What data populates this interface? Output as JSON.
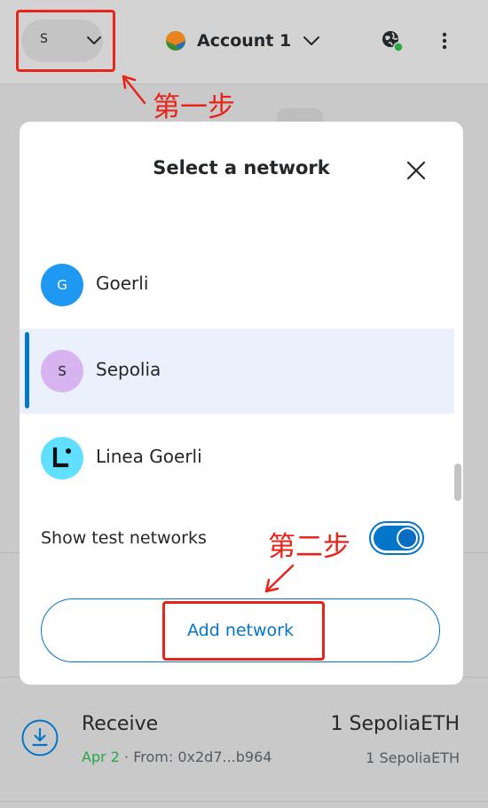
{
  "header": {
    "network_letter": "S",
    "account_name": "Account 1"
  },
  "modal": {
    "title": "Select a network",
    "networks": [
      {
        "label": "Goerli",
        "avatar_letter": "G",
        "avatar_bg": "#1e98f0",
        "avatar_fg": "#ffffff",
        "selected": false
      },
      {
        "label": "Sepolia",
        "avatar_letter": "S",
        "avatar_bg": "#d7b4f0",
        "avatar_fg": "#24272a",
        "selected": true
      },
      {
        "label": "Linea Goerli",
        "avatar_letter": "",
        "avatar_bg": "#61dfff",
        "avatar_fg": "#121212",
        "selected": false
      }
    ],
    "toggle_label": "Show test networks",
    "toggle_on": true,
    "add_network_label": "Add network"
  },
  "activity": {
    "title": "Receive",
    "amount": "1 SepoliaETH",
    "date": "Apr 2",
    "from": " · From: 0x2d7...b964",
    "sub_amount": "1 SepoliaETH"
  },
  "annotations": {
    "step1": "第一步",
    "step2": "第二步"
  },
  "colors": {
    "accent": "#0376c9",
    "annotation": "#e8241a",
    "success": "#28a745"
  }
}
